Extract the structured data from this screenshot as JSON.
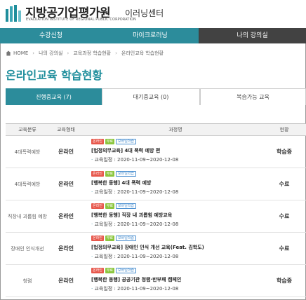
{
  "header": {
    "title": "지방공기업평가원",
    "subtitle": "EVALUATION INSTITUTE OF REGIONAL PUBLIC CORPORATION",
    "elearning": "이러닝센터"
  },
  "topnav": {
    "items": [
      {
        "label": "수강신청"
      },
      {
        "label": "마이크로러닝"
      },
      {
        "label": "나의 강의실"
      }
    ]
  },
  "breadcrumb": {
    "home": "HOME",
    "items": [
      "나의 강의실",
      "교육과정 학습현황",
      "온라인교육 학습현황"
    ]
  },
  "page": {
    "title": "온라인교육 학습현황"
  },
  "tabs": [
    {
      "label": "진행중교육 (7)"
    },
    {
      "label": "대기중교육 (0)"
    },
    {
      "label": "복습가능 교육"
    }
  ],
  "table": {
    "headers": {
      "category": "교육분류",
      "type": "교육형태",
      "course": "과정명",
      "status": "현황"
    },
    "badges": {
      "online": "온라인",
      "free": "무료",
      "mobile": "모바일학습"
    },
    "period_label": "교육일정",
    "rows": [
      {
        "category": "4대폭력예방",
        "type": "온라인",
        "title": "[법정의무교육] 4대 폭력 예방 편",
        "period": "2020-11-09~2020-12-08",
        "status": "학습중"
      },
      {
        "category": "4대폭력예방",
        "type": "온라인",
        "title": "[행복한 동행] 4대 폭력 예방",
        "period": "2020-11-09~2020-12-08",
        "status": "수료"
      },
      {
        "category": "직장내 괴롭힘 예방",
        "type": "온라인",
        "title": "[행복한 동행] 직장 내 괴롭힘 예방교육",
        "period": "2020-11-09~2020-12-08",
        "status": "수료"
      },
      {
        "category": "장애인 인식개선",
        "type": "온라인",
        "title": "[법정의무교육] 장애인 인식 개선 교육(Feat. 김학도)",
        "period": "2020-11-09~2020-12-08",
        "status": "수료"
      },
      {
        "category": "청렴",
        "type": "온라인",
        "title": "[행복한 동행] 공공기관 청렴·반부패 캠페인",
        "period": "2020-11-09~2020-12-08",
        "status": "학습중"
      }
    ]
  },
  "colors": {
    "accent": "#2c8c9b",
    "nav_active": "#424242",
    "title": "#1f8e9c",
    "badge_red": "#e7574b",
    "badge_green": "#8cc63f",
    "badge_blue": "#4a8fd0"
  }
}
